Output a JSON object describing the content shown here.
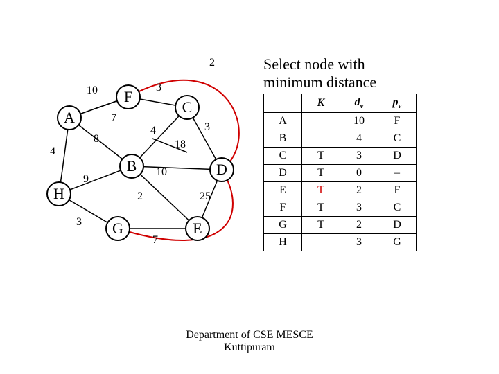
{
  "title_line1": "Select node with",
  "title_line2": "minimum distance",
  "nodes": {
    "A": "A",
    "B": "B",
    "C": "C",
    "D": "D",
    "E": "E",
    "F": "F",
    "G": "G",
    "H": "H"
  },
  "edge_weights": {
    "FA": "10",
    "AF": "7",
    "AH": "4",
    "AB": "8",
    "HB": "9",
    "HG": "3",
    "FC": "3",
    "BC": "4",
    "BE": "2",
    "GE": "7",
    "CD": "3",
    "BD": "10",
    "BDe": "18",
    "ED": "25",
    "FD": "2"
  },
  "table": {
    "headers": {
      "K": "K",
      "dv": "d",
      "dvs": "v",
      "pv": "p",
      "pvs": "v"
    },
    "rows": [
      {
        "n": "A",
        "K": "",
        "d": "10",
        "p": "F",
        "red": false
      },
      {
        "n": "B",
        "K": "",
        "d": "4",
        "p": "C",
        "red": false
      },
      {
        "n": "C",
        "K": "T",
        "d": "3",
        "p": "D",
        "red": false
      },
      {
        "n": "D",
        "K": "T",
        "d": "0",
        "p": "–",
        "red": false
      },
      {
        "n": "E",
        "K": "T",
        "d": "2",
        "p": "F",
        "red": true
      },
      {
        "n": "F",
        "K": "T",
        "d": "3",
        "p": "C",
        "red": false
      },
      {
        "n": "G",
        "K": "T",
        "d": "2",
        "p": "D",
        "red": false
      },
      {
        "n": "H",
        "K": "",
        "d": "3",
        "p": "G",
        "red": false
      }
    ]
  },
  "footer1": "Department of CSE MESCE",
  "footer2": "Kuttipuram"
}
